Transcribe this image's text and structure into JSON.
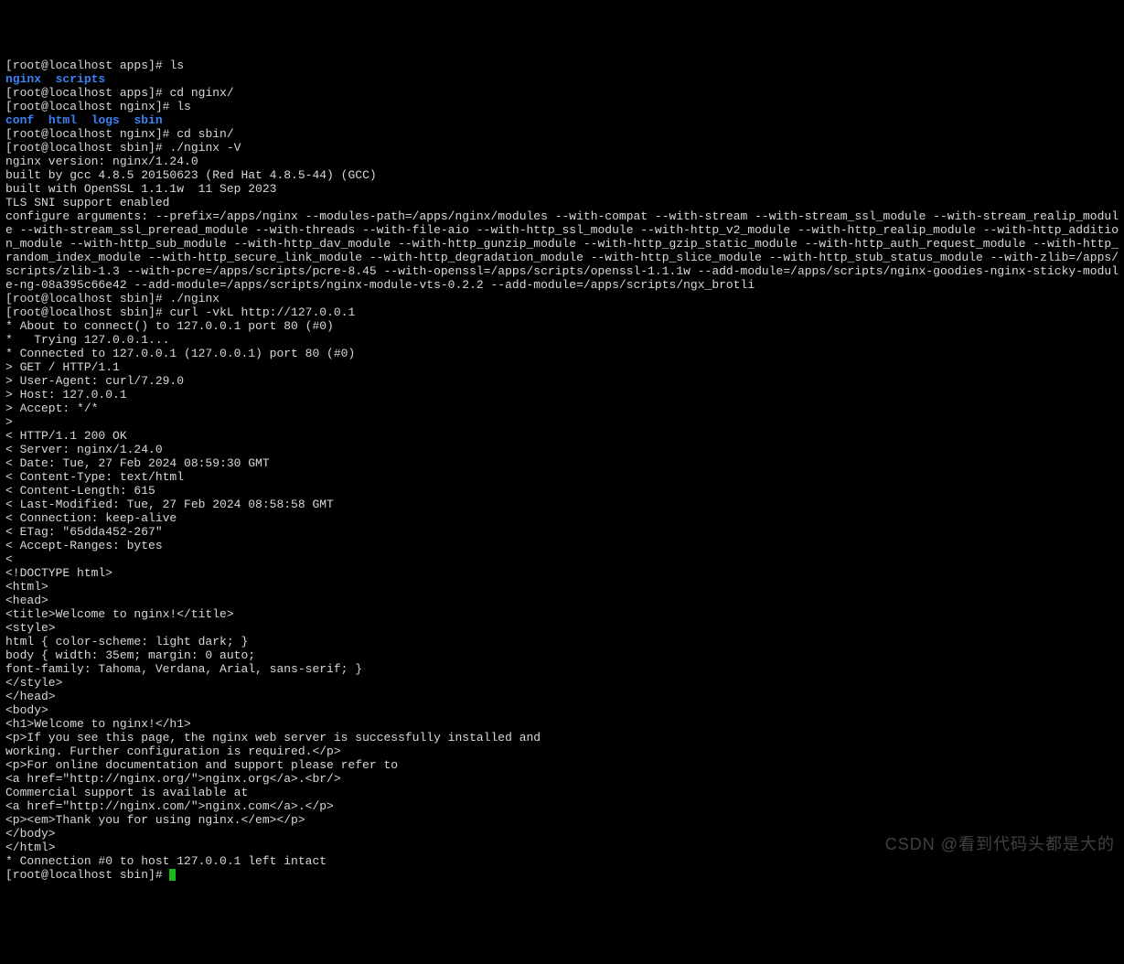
{
  "lines": [
    {
      "type": "prompt",
      "prompt": "[root@localhost apps]# ",
      "cmd": "ls"
    },
    {
      "type": "dirs",
      "items": [
        "nginx",
        "  ",
        "scripts"
      ]
    },
    {
      "type": "prompt",
      "prompt": "[root@localhost apps]# ",
      "cmd": "cd nginx/"
    },
    {
      "type": "prompt",
      "prompt": "[root@localhost nginx]# ",
      "cmd": "ls"
    },
    {
      "type": "dirs",
      "items": [
        "conf",
        "  ",
        "html",
        "  ",
        "logs",
        "  ",
        "sbin"
      ]
    },
    {
      "type": "prompt",
      "prompt": "[root@localhost nginx]# ",
      "cmd": "cd sbin/"
    },
    {
      "type": "prompt",
      "prompt": "[root@localhost sbin]# ",
      "cmd": "./nginx -V"
    },
    {
      "type": "text",
      "text": "nginx version: nginx/1.24.0"
    },
    {
      "type": "text",
      "text": "built by gcc 4.8.5 20150623 (Red Hat 4.8.5-44) (GCC)"
    },
    {
      "type": "text",
      "text": "built with OpenSSL 1.1.1w  11 Sep 2023"
    },
    {
      "type": "text",
      "text": "TLS SNI support enabled"
    },
    {
      "type": "text",
      "text": "configure arguments: --prefix=/apps/nginx --modules-path=/apps/nginx/modules --with-compat --with-stream --with-stream_ssl_module --with-stream_realip_module --with-stream_ssl_preread_module --with-threads --with-file-aio --with-http_ssl_module --with-http_v2_module --with-http_realip_module --with-http_addition_module --with-http_sub_module --with-http_dav_module --with-http_gunzip_module --with-http_gzip_static_module --with-http_auth_request_module --with-http_random_index_module --with-http_secure_link_module --with-http_degradation_module --with-http_slice_module --with-http_stub_status_module --with-zlib=/apps/scripts/zlib-1.3 --with-pcre=/apps/scripts/pcre-8.45 --with-openssl=/apps/scripts/openssl-1.1.1w --add-module=/apps/scripts/nginx-goodies-nginx-sticky-module-ng-08a395c66e42 --add-module=/apps/scripts/nginx-module-vts-0.2.2 --add-module=/apps/scripts/ngx_brotli"
    },
    {
      "type": "prompt",
      "prompt": "[root@localhost sbin]# ",
      "cmd": "./nginx"
    },
    {
      "type": "prompt",
      "prompt": "[root@localhost sbin]# ",
      "cmd": "curl -vkL http://127.0.0.1"
    },
    {
      "type": "text",
      "text": "* About to connect() to 127.0.0.1 port 80 (#0)"
    },
    {
      "type": "text",
      "text": "*   Trying 127.0.0.1..."
    },
    {
      "type": "text",
      "text": "* Connected to 127.0.0.1 (127.0.0.1) port 80 (#0)"
    },
    {
      "type": "text",
      "text": "> GET / HTTP/1.1"
    },
    {
      "type": "text",
      "text": "> User-Agent: curl/7.29.0"
    },
    {
      "type": "text",
      "text": "> Host: 127.0.0.1"
    },
    {
      "type": "text",
      "text": "> Accept: */*"
    },
    {
      "type": "text",
      "text": ">"
    },
    {
      "type": "text",
      "text": "< HTTP/1.1 200 OK"
    },
    {
      "type": "text",
      "text": "< Server: nginx/1.24.0"
    },
    {
      "type": "text",
      "text": "< Date: Tue, 27 Feb 2024 08:59:30 GMT"
    },
    {
      "type": "text",
      "text": "< Content-Type: text/html"
    },
    {
      "type": "text",
      "text": "< Content-Length: 615"
    },
    {
      "type": "text",
      "text": "< Last-Modified: Tue, 27 Feb 2024 08:58:58 GMT"
    },
    {
      "type": "text",
      "text": "< Connection: keep-alive"
    },
    {
      "type": "text",
      "text": "< ETag: \"65dda452-267\""
    },
    {
      "type": "text",
      "text": "< Accept-Ranges: bytes"
    },
    {
      "type": "text",
      "text": "<"
    },
    {
      "type": "text",
      "text": "<!DOCTYPE html>"
    },
    {
      "type": "text",
      "text": "<html>"
    },
    {
      "type": "text",
      "text": "<head>"
    },
    {
      "type": "text",
      "text": "<title>Welcome to nginx!</title>"
    },
    {
      "type": "text",
      "text": "<style>"
    },
    {
      "type": "text",
      "text": "html { color-scheme: light dark; }"
    },
    {
      "type": "text",
      "text": "body { width: 35em; margin: 0 auto;"
    },
    {
      "type": "text",
      "text": "font-family: Tahoma, Verdana, Arial, sans-serif; }"
    },
    {
      "type": "text",
      "text": "</style>"
    },
    {
      "type": "text",
      "text": "</head>"
    },
    {
      "type": "text",
      "text": "<body>"
    },
    {
      "type": "text",
      "text": "<h1>Welcome to nginx!</h1>"
    },
    {
      "type": "text",
      "text": "<p>If you see this page, the nginx web server is successfully installed and"
    },
    {
      "type": "text",
      "text": "working. Further configuration is required.</p>"
    },
    {
      "type": "text",
      "text": ""
    },
    {
      "type": "text",
      "text": "<p>For online documentation and support please refer to"
    },
    {
      "type": "text",
      "text": "<a href=\"http://nginx.org/\">nginx.org</a>.<br/>"
    },
    {
      "type": "text",
      "text": "Commercial support is available at"
    },
    {
      "type": "text",
      "text": "<a href=\"http://nginx.com/\">nginx.com</a>.</p>"
    },
    {
      "type": "text",
      "text": ""
    },
    {
      "type": "text",
      "text": "<p><em>Thank you for using nginx.</em></p>"
    },
    {
      "type": "text",
      "text": "</body>"
    },
    {
      "type": "text",
      "text": "</html>"
    },
    {
      "type": "text",
      "text": "* Connection #0 to host 127.0.0.1 left intact"
    },
    {
      "type": "promptcursor",
      "prompt": "[root@localhost sbin]# "
    }
  ],
  "watermark": "CSDN @看到代码头都是大的"
}
